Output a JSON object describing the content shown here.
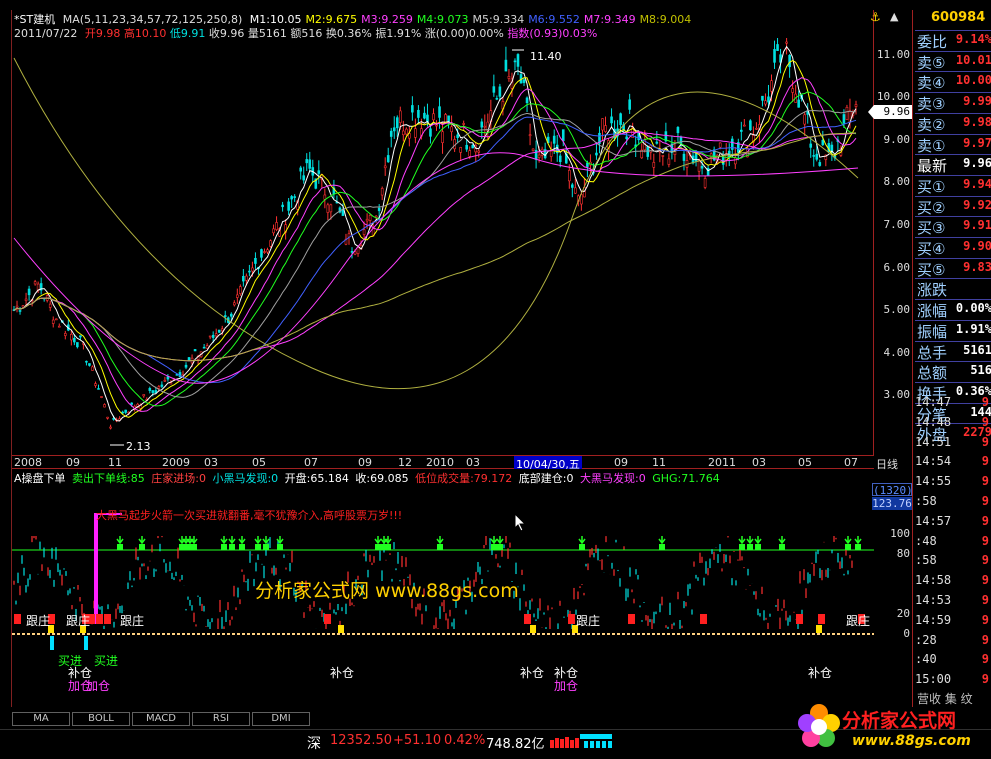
{
  "stock": {
    "name": "*ST建机",
    "code": "600984",
    "date": "2011/07/22"
  },
  "ma_legend": {
    "title": "MA(5,11,23,34,57,72,125,250,8)",
    "items": [
      {
        "label": "M1:10.05",
        "color": "#ffffff"
      },
      {
        "label": "M2:9.675",
        "color": "#ffff00"
      },
      {
        "label": "M3:9.259",
        "color": "#ff40ff"
      },
      {
        "label": "M4:9.073",
        "color": "#20ff20"
      },
      {
        "label": "M5:9.334",
        "color": "#d0d0d0"
      },
      {
        "label": "M6:9.552",
        "color": "#4060ff"
      },
      {
        "label": "M7:9.349",
        "color": "#ff40ff"
      },
      {
        "label": "M8:9.004",
        "color": "#c0c000"
      }
    ]
  },
  "quote_line": {
    "open": "开9.98",
    "high": "高10.10",
    "low": "低9.91",
    "close": "收9.96",
    "volume": "量5161",
    "amount": "额516",
    "turnover": "换0.36%",
    "amplitude": "振1.91%",
    "change": "涨(0.00)0.00%",
    "index": "指数(0.93)0.03%"
  },
  "price_axis": {
    "ticks": [
      "11.00",
      "10.00",
      "9.00",
      "8.00",
      "7.00",
      "6.00",
      "5.00",
      "4.00",
      "3.00"
    ],
    "current_price": "9.96",
    "high_label": "11.40",
    "low_label": "2.13"
  },
  "date_axis": {
    "ticks": [
      "2008",
      "09",
      "11",
      "2009",
      "03",
      "05",
      "07",
      "09",
      "12",
      "2010",
      "03",
      "07",
      "09",
      "11",
      "2011",
      "03",
      "05",
      "07"
    ],
    "highlight": "10/04/30,五",
    "period_label": "日线"
  },
  "indicator": {
    "title": "A操盘下单",
    "sell_signal": "卖出下单线:85",
    "dealer_in": "庄家进场:0",
    "dark_horse": "小黑马发现:0",
    "open_val": "开盘:65.184",
    "close_val": "收:69.085",
    "low_volume": "低位成交量:79.172",
    "bottom_build": "底部建仓:0",
    "big_horse": "大黑马发现:0",
    "ghg": "GHG:71.764",
    "top_box": "(1320)",
    "top_val": "123.76",
    "ticks": [
      "100",
      "80",
      "20",
      "0"
    ],
    "warning": "大黑马起步火箭一次买进就翻番,毫不犹豫介入,高呼股票万岁!!!",
    "watermark": "分析家公式网 www.88gs.com",
    "labels": {
      "follow": "跟庄",
      "buy": "买进",
      "add": "补仓",
      "plus": "加仓"
    }
  },
  "tabs": [
    "MA",
    "BOLL",
    "MACD",
    "RSI",
    "DMI"
  ],
  "status_bar": {
    "market": "深",
    "index": "12352.50",
    "change": "+51.10",
    "pct": "0.42%",
    "amount": "748.82亿"
  },
  "order_book": {
    "ratio_label": "委比",
    "ratio_value": "9.14%",
    "asks": [
      {
        "label": "卖⑤",
        "value": "10.01"
      },
      {
        "label": "卖④",
        "value": "10.00"
      },
      {
        "label": "卖③",
        "value": "9.99"
      },
      {
        "label": "卖②",
        "value": "9.98"
      },
      {
        "label": "卖①",
        "value": "9.97"
      }
    ],
    "last_label": "最新",
    "last_value": "9.96",
    "bids": [
      {
        "label": "买①",
        "value": "9.94"
      },
      {
        "label": "买②",
        "value": "9.92"
      },
      {
        "label": "买③",
        "value": "9.91"
      },
      {
        "label": "买④",
        "value": "9.90"
      },
      {
        "label": "买⑤",
        "value": "9.83"
      }
    ],
    "stats": [
      {
        "label": "涨跌",
        "value": ""
      },
      {
        "label": "涨幅",
        "value": "0.00%"
      },
      {
        "label": "振幅",
        "value": "1.91%"
      },
      {
        "label": "总手",
        "value": "5161"
      },
      {
        "label": "总额",
        "value": "516"
      },
      {
        "label": "换手",
        "value": "0.36%"
      },
      {
        "label": "分笔",
        "value": "144"
      },
      {
        "label": "外盘",
        "value": "2279"
      }
    ],
    "ticks": [
      {
        "time": "14:47",
        "value": "9"
      },
      {
        "time": "14:48",
        "value": "9"
      },
      {
        "time": "14:51",
        "value": "9"
      },
      {
        "time": "14:54",
        "value": "9"
      },
      {
        "time": "14:55",
        "value": "9"
      },
      {
        "time": ":58",
        "value": "9"
      },
      {
        "time": "14:57",
        "value": "9"
      },
      {
        "time": ":48",
        "value": "9"
      },
      {
        "time": ":58",
        "value": "9"
      },
      {
        "time": "14:58",
        "value": "9"
      },
      {
        "time": "14:53",
        "value": "9"
      },
      {
        "time": "14:59",
        "value": "9"
      },
      {
        "time": ":28",
        "value": "9"
      },
      {
        "time": ":40",
        "value": "9"
      },
      {
        "time": "15:00",
        "value": "9"
      }
    ],
    "footer": "营收 集 纹"
  },
  "logo": {
    "text": "分析家公式网",
    "url": "www.88gs.com"
  },
  "colors": {
    "up": "#ff3030",
    "down": "#00e0e0",
    "grid_red": "#a02020"
  }
}
